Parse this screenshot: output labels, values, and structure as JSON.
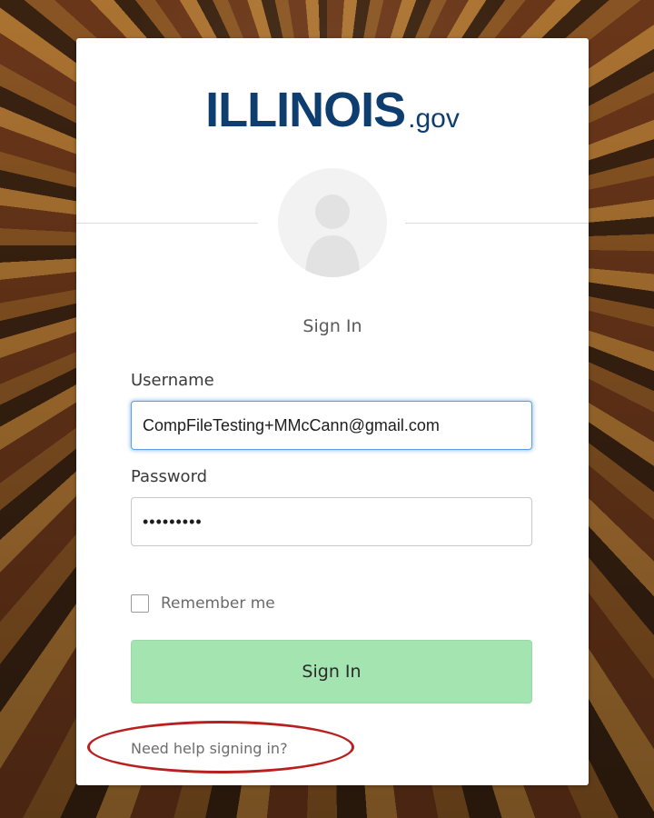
{
  "logo": {
    "main": "ILLINOIS",
    "suffix": ".gov",
    "brand_color": "#0e3d70"
  },
  "form": {
    "title": "Sign In",
    "username_label": "Username",
    "username_value": "CompFileTesting+MMcCann@gmail.com",
    "password_label": "Password",
    "password_value": "•••••••••",
    "remember_label": "Remember me",
    "remember_checked": false,
    "submit_label": "Sign In",
    "submit_color": "#a3e4b0",
    "help_link": "Need help signing in?"
  },
  "annotation": {
    "color": "#b81f1f"
  }
}
